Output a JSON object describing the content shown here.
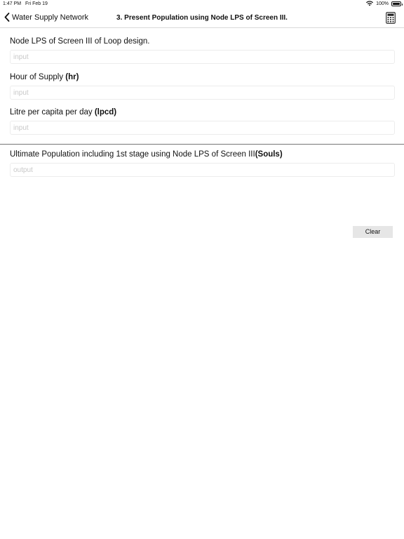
{
  "status_bar": {
    "time": "1:47 PM",
    "date": "Fri Feb 19",
    "battery_text": "100%",
    "battery_level": 1.0,
    "wifi_icon": "wifi-icon",
    "battery_icon": "battery-icon"
  },
  "nav": {
    "back_label": "Water Supply Network",
    "back_icon": "chevron-left-icon",
    "title": "3. Present Population using Node LPS of Screen III.",
    "calculator_icon": "calculator-icon"
  },
  "fields": [
    {
      "label": "Node LPS of Screen III of Loop design.",
      "unit": "",
      "placeholder": "input"
    },
    {
      "label": "Hour of Supply ",
      "unit": "(hr)",
      "placeholder": "input"
    },
    {
      "label": "Litre per capita per day ",
      "unit": "(lpcd)",
      "placeholder": "input"
    }
  ],
  "result": {
    "label": "Ultimate Population including 1st stage using Node LPS of Screen III",
    "unit": "(Souls)",
    "placeholder": "output"
  },
  "clear_label": "Clear"
}
